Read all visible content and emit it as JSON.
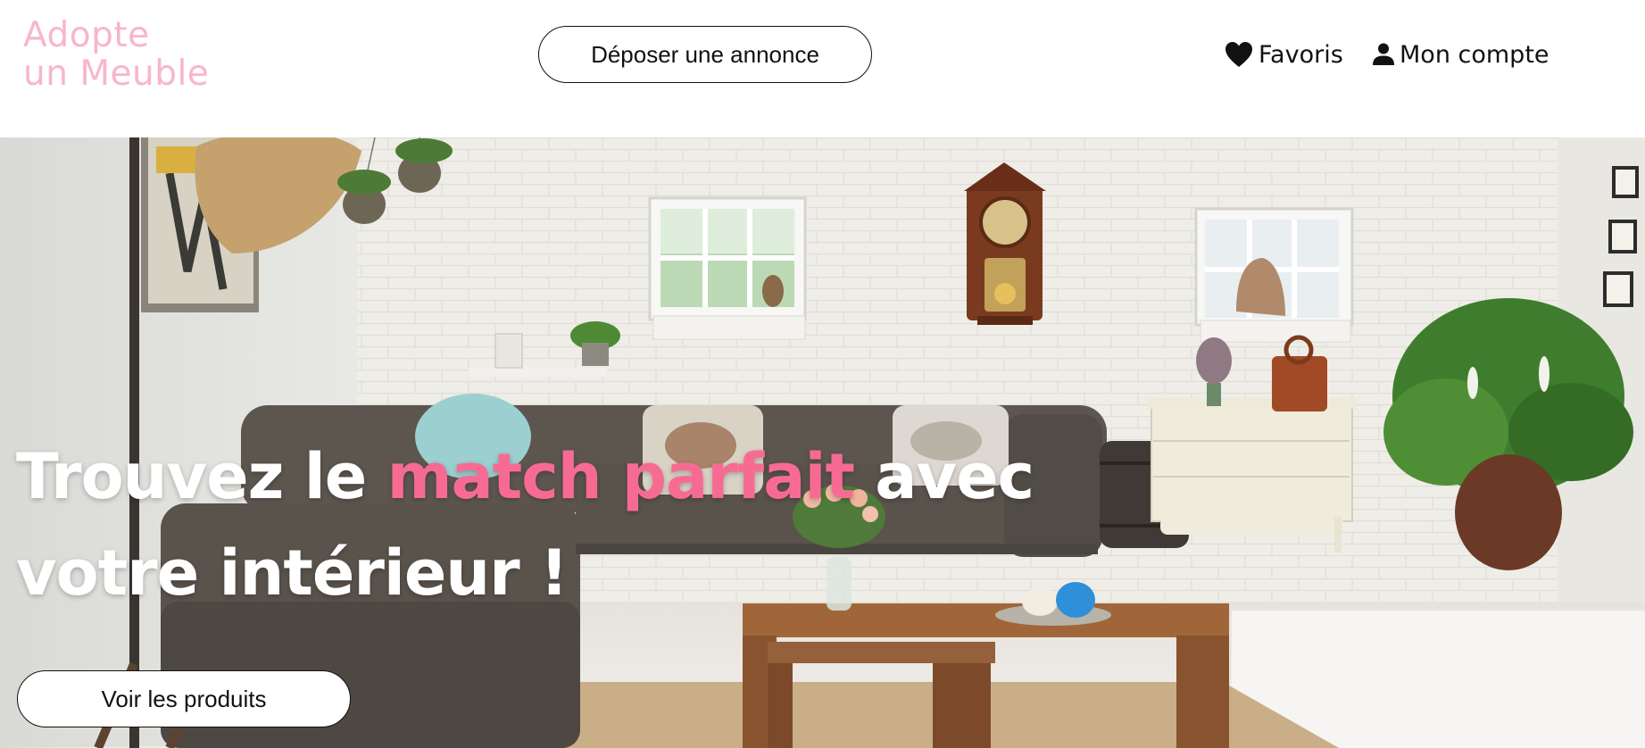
{
  "header": {
    "logo_line1": "Adopte",
    "logo_line2": "un Meuble",
    "post_ad_label": "Déposer une annonce",
    "favorites_label": "Favoris",
    "favorites_icon": "heart-icon",
    "account_label": "Mon compte",
    "account_icon": "user-icon"
  },
  "hero": {
    "headline_part1": "Trouvez le ",
    "headline_accent": "match parfait",
    "headline_part2": " avec",
    "headline_line2": "votre intérieur !",
    "cta_label": "Voir les produits"
  },
  "colors": {
    "logo": "#f7b6cc",
    "accent": "#f76b93",
    "text": "#111111",
    "background": "#ffffff"
  }
}
